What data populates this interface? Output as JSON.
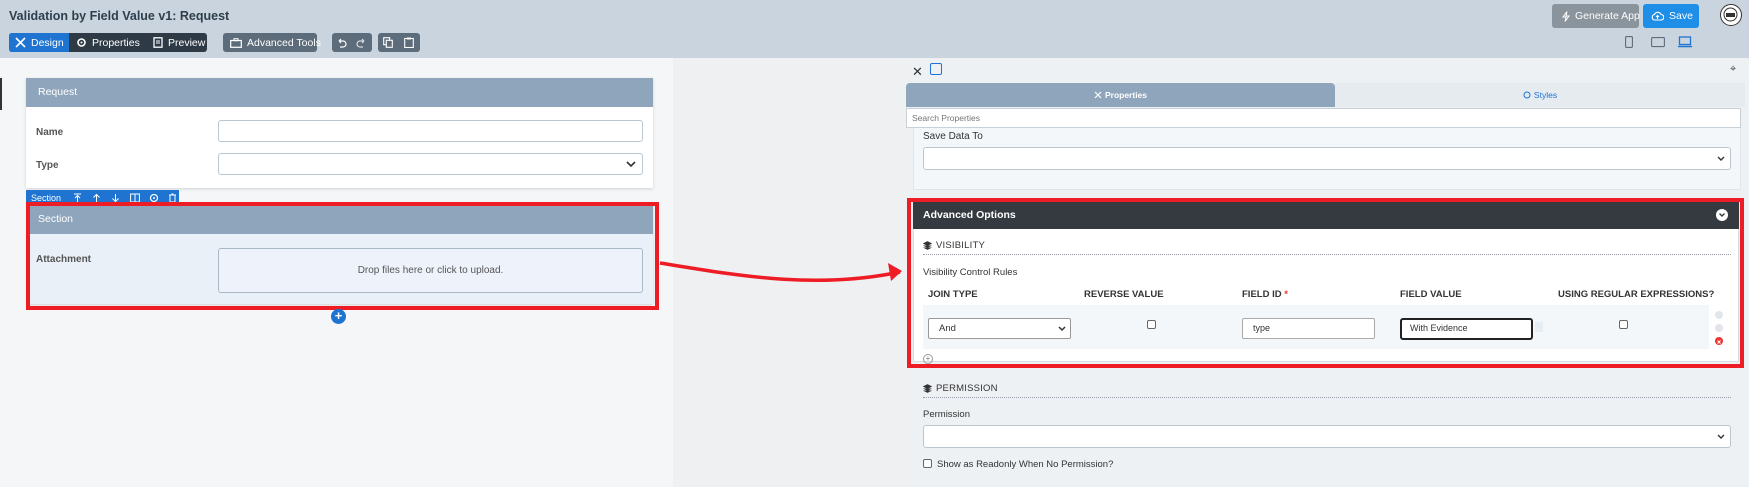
{
  "header": {
    "title": "Validation by Field Value v1: Request",
    "modes": {
      "design": "Design",
      "properties": "Properties",
      "preview": "Preview"
    },
    "advanced_tools": "Advanced Tools",
    "generate_app": "Generate App",
    "save": "Save"
  },
  "form": {
    "request_section_title": "Request",
    "name_label": "Name",
    "type_label": "Type",
    "section_toolbar_label": "Section",
    "section_title": "Section",
    "attachment_label": "Attachment",
    "dropzone_text": "Drop files here or click to upload."
  },
  "panel": {
    "tabs": {
      "properties": "Properties",
      "styles": "Styles"
    },
    "search_placeholder": "Search Properties",
    "save_data_to_label": "Save Data To",
    "advanced_options_title": "Advanced Options",
    "visibility": {
      "heading": "VISIBILITY",
      "rules_label": "Visibility Control Rules",
      "columns": {
        "join_type": "JOIN TYPE",
        "reverse_value": "REVERSE VALUE",
        "field_id": "FIELD ID",
        "required_mark": "*",
        "field_value": "FIELD VALUE",
        "using_regex": "USING REGULAR EXPRESSIONS?"
      },
      "rows": [
        {
          "join_type": "And",
          "reverse_value": false,
          "field_id": "type",
          "field_value": "With Evidence",
          "using_regex": false
        }
      ]
    },
    "permission": {
      "heading": "PERMISSION",
      "label": "Permission",
      "readonly_option": "Show as Readonly When No Permission?"
    }
  },
  "colors": {
    "accent_blue": "#1e74d0",
    "highlight_red": "#ee1c24",
    "section_header": "#8fa5bc",
    "dark_header": "#343a40"
  }
}
